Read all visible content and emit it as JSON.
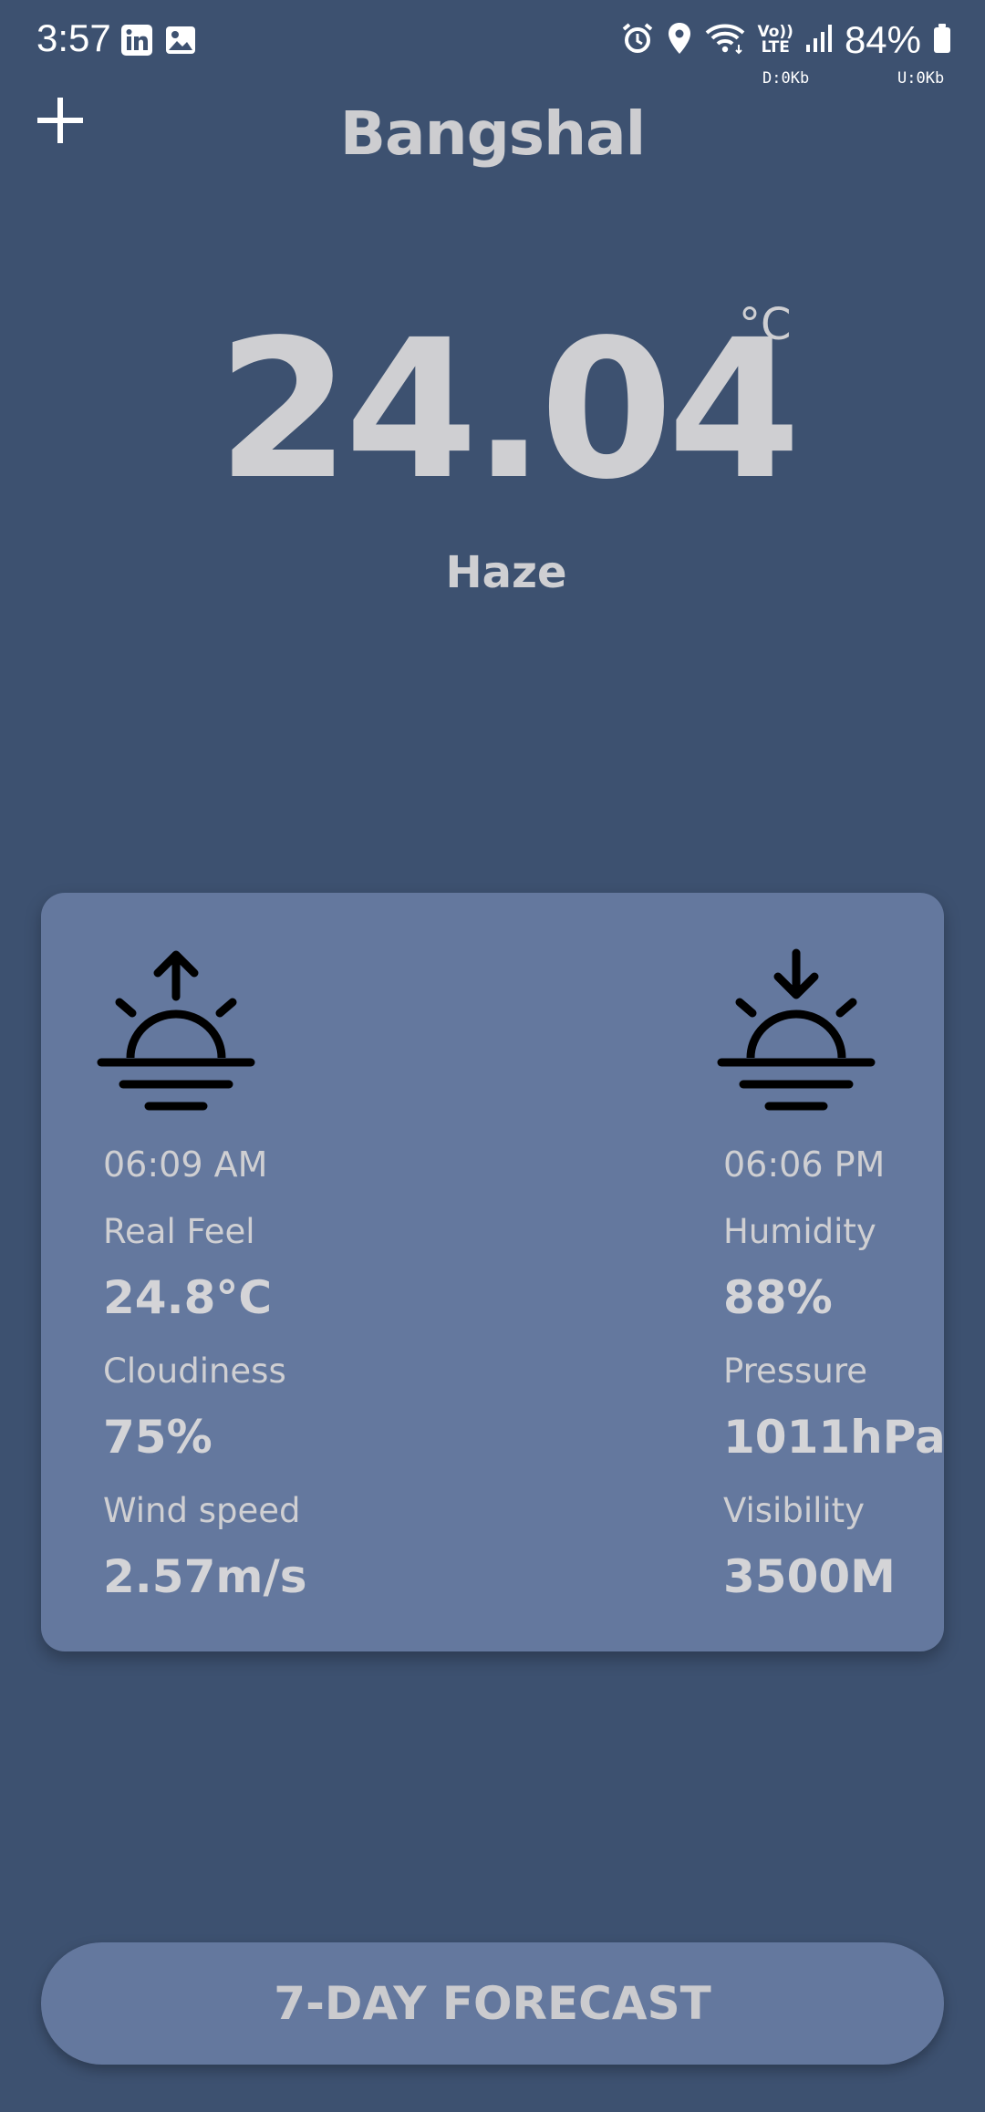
{
  "status_bar": {
    "time": "3:57",
    "left_icons": [
      "linkedin-icon",
      "image-icon"
    ],
    "right_icons": [
      "alarm-icon",
      "location-icon",
      "wifi-icon",
      "volte-icon",
      "signal-icon",
      "battery-icon"
    ],
    "volte_label_top": "Vo))",
    "volte_label_bottom": "LTE",
    "battery": "84%",
    "net_down": "D:0Kb",
    "net_up": "U:0Kb"
  },
  "header": {
    "add_icon": "plus-icon",
    "city": "Bangshal"
  },
  "current": {
    "temperature": "24.04",
    "unit": "°C",
    "condition": "Haze"
  },
  "details": {
    "sunrise": {
      "icon": "sunrise-icon",
      "time": "06:09 AM"
    },
    "sunset": {
      "icon": "sunset-icon",
      "time": "06:06 PM"
    },
    "left": [
      {
        "label": "Real Feel",
        "value": "24.8°C"
      },
      {
        "label": "Cloudiness",
        "value": "75%"
      },
      {
        "label": "Wind speed",
        "value": "2.57m/s"
      }
    ],
    "right": [
      {
        "label": "Humidity",
        "value": "88%"
      },
      {
        "label": "Pressure",
        "value": "1011hPa"
      },
      {
        "label": "Visibility",
        "value": "3500M"
      }
    ]
  },
  "forecast_button": {
    "label": "7-DAY FORECAST"
  },
  "colors": {
    "background": "#3d5170",
    "card": "#64789e",
    "text": "#cfcfd2"
  }
}
